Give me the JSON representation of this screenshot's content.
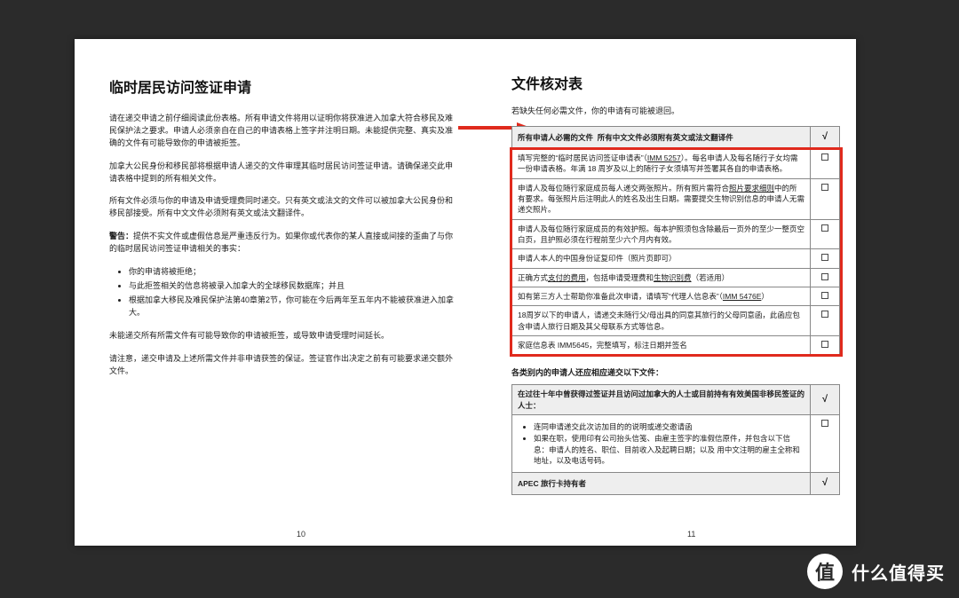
{
  "left": {
    "title": "临时居民访问签证申请",
    "p1": "请在递交申请之前仔细阅读此份表格。所有申请文件将用以证明你将获准进入加拿大符合移民及难民保护法之要求。申请人必须亲自在自己的申请表格上签字并注明日期。未能提供完整、真实及准确的文件有可能导致你的申请被拒签。",
    "p2": "加拿大公民身份和移民部将根据申请人递交的文件审理其临时居民访问签证申请。请确保递交此申请表格中提到的所有相关文件。",
    "p3": "所有文件必须与你的申请及申请受理费同时递交。只有英文或法文的文件可以被加拿大公民身份和移民部接受。所有中文文件必须附有英文或法文翻译件。",
    "warn_label": "警告：",
    "warn": "提供不实文件或虚假信息是严重违反行为。如果你或代表你的某人直接或间接的歪曲了与你的临时居民访问签证申请相关的事实：",
    "ul": [
      "你的申请将被拒绝；",
      "与此拒签相关的信息将被录入加拿大的全球移民数据库；并且",
      "根据加拿大移民及难民保护法第40章第2节，你可能在今后两年至五年内不能被获准进入加拿大。"
    ],
    "p4": "未能递交所有所需文件有可能导致你的申请被拒签，或导致申请受理时间延长。",
    "p5": "请注意，递交申请及上述所需文件并非申请获签的保证。签证官作出决定之前有可能要求递交额外文件。"
  },
  "right": {
    "title": "文件核对表",
    "intro": "若缺失任何必需文件，你的申请有可能被退回。",
    "table1_header_a": "所有申请人必需的文件",
    "table1_header_b": "所有中文文件必须附有英文或法文翻译件",
    "mark": "√",
    "rows1": [
      {
        "text_a": "填写完整的“临时居民访问签证申请表”（",
        "link": "IMM 5257",
        "text_b": "）。每名申请人及每名随行子女均需一份申请表格。年满 18 周岁及以上的随行子女须填写并签署其各自的申请表格。"
      },
      {
        "text": "申请人及每位随行家庭成员每人递交两张照片。所有照片需符合照片要求细则中的所有要求。每张照片后注明此人的姓名及出生日期。需要提交生物识别信息的申请人无需递交照片。",
        "ulinks": [
          "照片要求细则"
        ]
      },
      {
        "text": "申请人及每位随行家庭成员的有效护照。每本护照须包含除最后一页外的至少一整页空白页，且护照必须在行程前至少六个月内有效。"
      },
      {
        "text": "申请人本人的中国身份证复印件（照片页即可）"
      },
      {
        "text_a": "正确方式",
        "ul1": "支付的费用",
        "text_b": "，包括申请受理费和",
        "ul2": "生物识别费",
        "text_c": "（若适用）"
      },
      {
        "text_a": "如有第三方人士帮助你准备此次申请，请填写“代理人信息表”（",
        "link": "IMM 5476E",
        "text_b": "）"
      },
      {
        "text": "18周岁以下的申请人，请递交未随行父/母出具的同意其旅行的父母同意函，此函应包含申请人旅行日期及其父母联系方式等信息。"
      },
      {
        "text": "家庭信息表 IMM5645，完整填写，标注日期并签名"
      }
    ],
    "sect_label": "各类别内的申请人还应相应递交以下文件：",
    "table2_header": "在过往十年中曾获得过签证并且访问过加拿大的人士或目前持有有效美国非移民签证的人士：",
    "rows2": [
      {
        "bullets": [
          "连同申请递交此次访加目的的说明或递交邀请函",
          "如果在职，使用印有公司抬头信笺、由雇主签字的准假信原件，并包含以下信息：申请人的姓名、职位、目前收入及起聘日期；以及 用中文注明的雇主全称和地址，以及电话号码。"
        ]
      }
    ],
    "table2_footer": "APEC 旅行卡持有者"
  },
  "pagenum_left": "10",
  "pagenum_right": "11",
  "badge": {
    "circle": "值",
    "text": "什么值得买"
  }
}
